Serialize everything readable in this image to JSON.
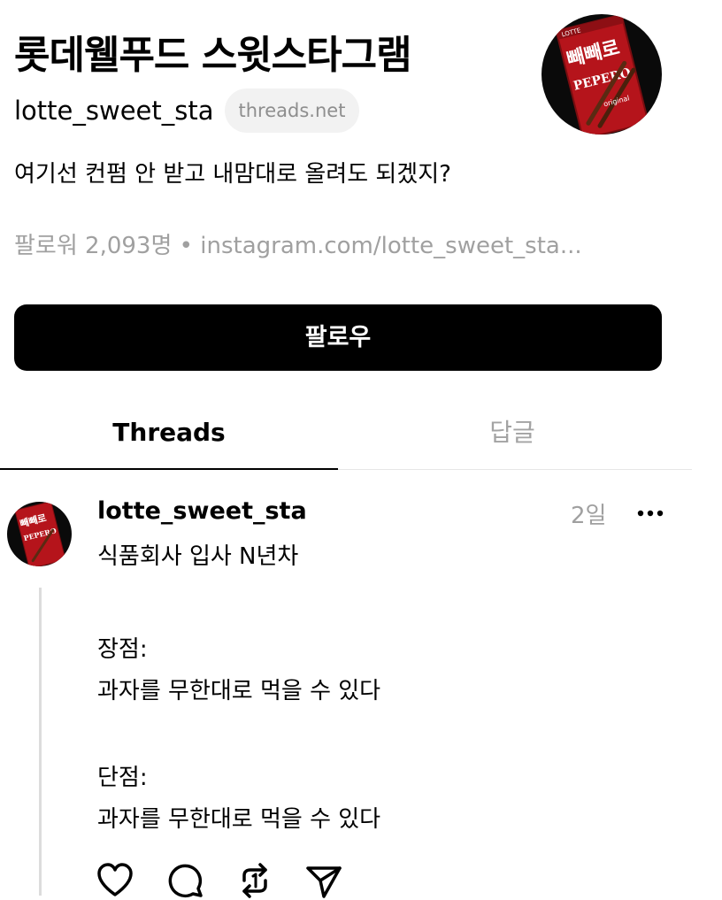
{
  "profile": {
    "name": "롯데웰푸드 스윗스타그램",
    "handle": "lotte_sweet_sta",
    "domain_chip": "threads.net",
    "bio": "여기선 컨펌 안 받고 내맘대로 올려도 되겠지?",
    "followers": "팔로워 2,093명",
    "separator": "•",
    "link": "instagram.com/lotte_sweet_sta...",
    "avatar_brand": "LOTTE",
    "avatar_product": "빼빼로",
    "avatar_product_en": "PEPERO",
    "avatar_variant": "original"
  },
  "follow_button": {
    "label": "팔로우"
  },
  "tabs": [
    {
      "label": "Threads",
      "active": true
    },
    {
      "label": "답글",
      "active": false
    }
  ],
  "post": {
    "username": "lotte_sweet_sta",
    "time": "2일",
    "lines": [
      "식품회사 입사 N년차",
      "장점:",
      "과자를 무한대로 먹을 수 있다",
      "단점:",
      "과자를 무한대로 먹을 수 있다"
    ],
    "actions": [
      "heart-icon",
      "comment-icon",
      "repost-icon",
      "share-icon"
    ]
  },
  "colors": {
    "text": "#000000",
    "muted": "#a0a0a0",
    "chip_bg": "#f2f2f2",
    "button_bg": "#000000",
    "brand_red": "#b5141b"
  }
}
